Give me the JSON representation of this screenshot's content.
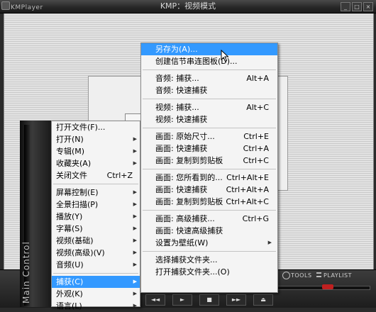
{
  "window": {
    "app_name": "KMPlayer",
    "title": "KMP：视频模式",
    "btn_min": "_",
    "btn_max": "□",
    "btn_close": "×"
  },
  "controlbar": {
    "tools_label": "TOOLS",
    "playlist_label": "PLAYLIST",
    "seek_position": 0.82,
    "transport": [
      "◄◄",
      "►",
      "■",
      "►►",
      "⏏"
    ]
  },
  "banner": {
    "text": "Main Control"
  },
  "main_menu": {
    "items": [
      {
        "label": "打开文件(F)...",
        "shortcut": "",
        "arrow": false
      },
      {
        "label": "打开(N)",
        "shortcut": "",
        "arrow": true
      },
      {
        "label": "专辑(M)",
        "shortcut": "",
        "arrow": true
      },
      {
        "label": "收藏夹(A)",
        "shortcut": "",
        "arrow": true
      },
      {
        "label": "关闭文件",
        "shortcut": "Ctrl+Z",
        "arrow": false
      },
      {
        "sep": true
      },
      {
        "label": "屏幕控制(E)",
        "shortcut": "",
        "arrow": true
      },
      {
        "label": "全景扫描(P)",
        "shortcut": "",
        "arrow": true
      },
      {
        "label": "播放(Y)",
        "shortcut": "",
        "arrow": true
      },
      {
        "label": "字幕(S)",
        "shortcut": "",
        "arrow": true
      },
      {
        "label": "视频(基础)",
        "shortcut": "",
        "arrow": true
      },
      {
        "label": "视频(高级)(V)",
        "shortcut": "",
        "arrow": true
      },
      {
        "label": "音频(U)",
        "shortcut": "",
        "arrow": true
      },
      {
        "sep": true
      },
      {
        "label": "捕获(C)",
        "shortcut": "",
        "arrow": true,
        "highlight": true
      },
      {
        "label": "外观(K)",
        "shortcut": "",
        "arrow": true
      },
      {
        "label": "语言(L)",
        "shortcut": "",
        "arrow": true
      }
    ]
  },
  "capture_menu": {
    "items": [
      {
        "label": "另存为(A)...",
        "shortcut": "",
        "highlight": true
      },
      {
        "label": "创建信节串连图板(D)...",
        "shortcut": ""
      },
      {
        "sep": true
      },
      {
        "label": "音频: 捕获...",
        "shortcut": "Alt+A"
      },
      {
        "label": "音频: 快速捕获",
        "shortcut": ""
      },
      {
        "sep": true
      },
      {
        "label": "视频: 捕获...",
        "shortcut": "Alt+C"
      },
      {
        "label": "视频: 快速捕获",
        "shortcut": ""
      },
      {
        "sep": true
      },
      {
        "label": "画面: 原始尺寸...",
        "shortcut": "Ctrl+E"
      },
      {
        "label": "画面: 快速捕获",
        "shortcut": "Ctrl+A"
      },
      {
        "label": "画面: 复制到剪贴板",
        "shortcut": "Ctrl+C"
      },
      {
        "sep": true
      },
      {
        "label": "画面: 您所看到的...",
        "shortcut": "Ctrl+Alt+E"
      },
      {
        "label": "画面: 快速捕获",
        "shortcut": "Ctrl+Alt+A"
      },
      {
        "label": "画面: 复制到剪贴板",
        "shortcut": "Ctrl+Alt+C"
      },
      {
        "sep": true
      },
      {
        "label": "画面: 高级捕获...",
        "shortcut": "Ctrl+G"
      },
      {
        "label": "画面: 快速高级捕获",
        "shortcut": ""
      },
      {
        "label": "设置为壁纸(W)",
        "shortcut": "",
        "arrow": true
      },
      {
        "sep": true
      },
      {
        "label": "选择捕获文件夹...",
        "shortcut": ""
      },
      {
        "label": "打开捕获文件夹...(O)",
        "shortcut": ""
      }
    ]
  }
}
